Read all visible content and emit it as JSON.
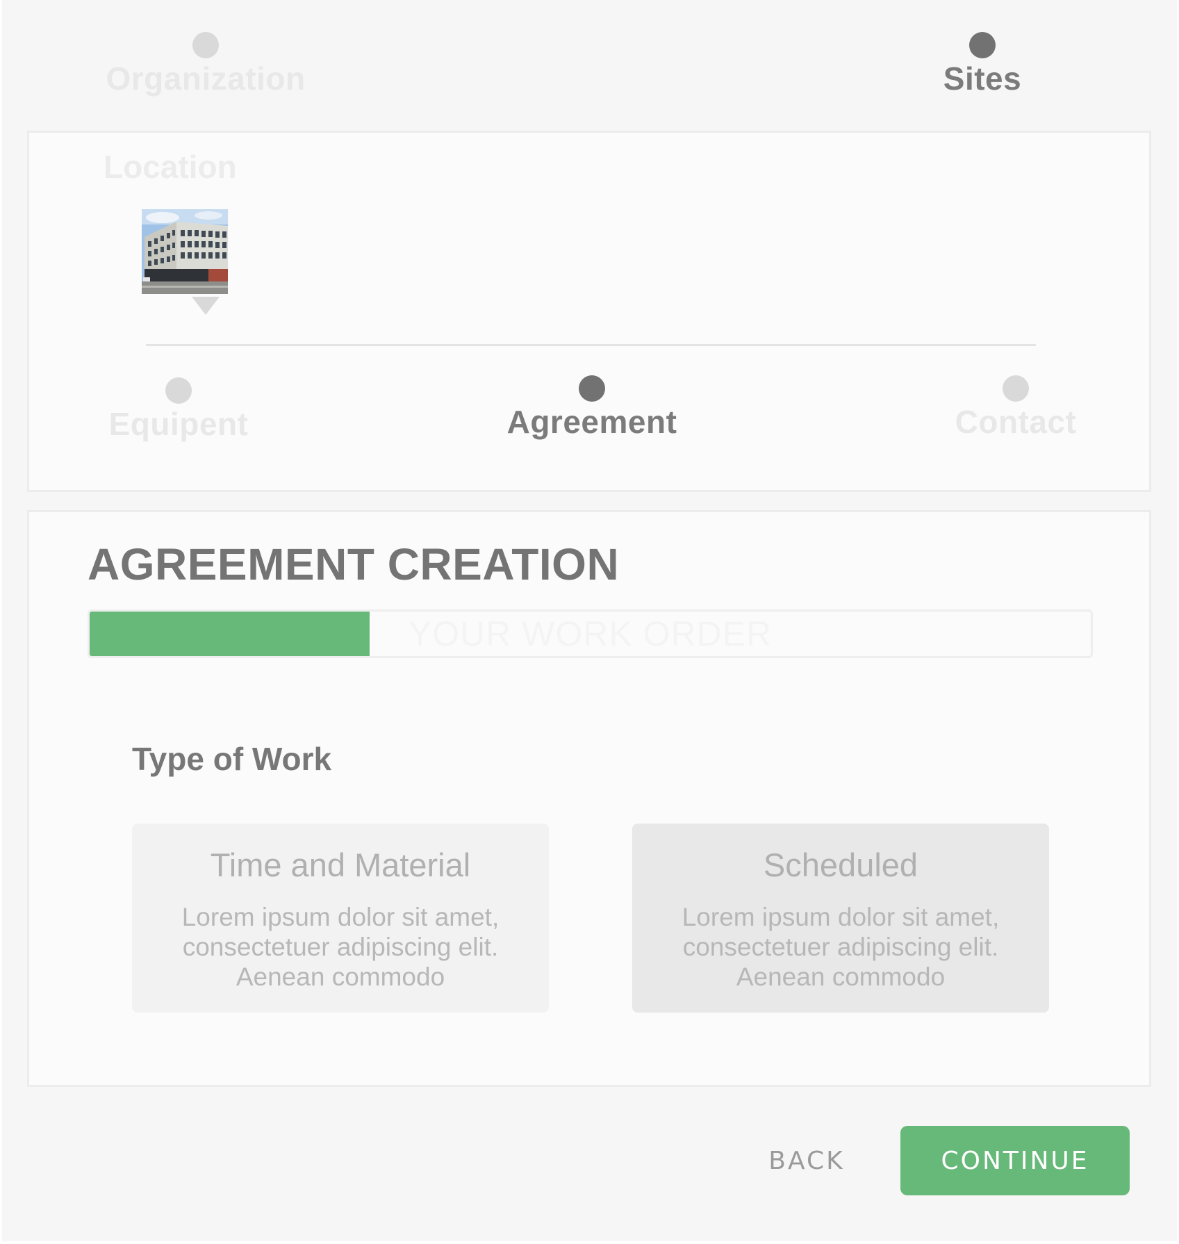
{
  "top_stepper": {
    "steps": [
      {
        "label": "Organization",
        "state": "inactive"
      },
      {
        "label": "Sites",
        "state": "active"
      }
    ]
  },
  "sites_card": {
    "location_label": "Location",
    "location_image": "building-photo",
    "sub_steps": [
      {
        "label": "Equipent",
        "state": "inactive"
      },
      {
        "label": "Agreement",
        "state": "active"
      },
      {
        "label": "Contact",
        "state": "inactive"
      }
    ]
  },
  "agreement": {
    "title": "AGREEMENT CREATION",
    "progress": {
      "label": "YOUR WORK ORDER",
      "fraction": 0.28
    },
    "type_of_work_label": "Type of Work",
    "options": [
      {
        "title": "Time and Material",
        "description": "Lorem ipsum dolor sit amet, consectetuer adipiscing elit. Aenean commodo"
      },
      {
        "title": "Scheduled",
        "description": "Lorem ipsum dolor sit amet, consectetuer adipiscing elit. Aenean commodo"
      }
    ]
  },
  "footer": {
    "back_label": "BACK",
    "continue_label": "CONTINUE"
  },
  "colors": {
    "accent_green": "#67b97a",
    "active_dot": "#727272",
    "inactive_dot": "#d9d9d9",
    "background": "#f6f6f6"
  }
}
